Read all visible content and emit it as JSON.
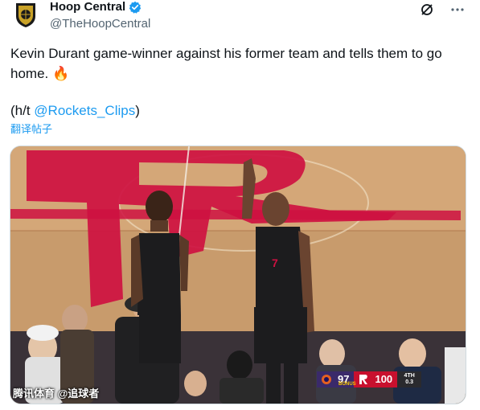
{
  "author": {
    "display_name": "Hoop Central",
    "handle": "@TheHoopCentral"
  },
  "tweet": {
    "text": "Kevin Durant game-winner against his former team and tells them to go home. 🔥",
    "ht_prefix": "(h/t ",
    "ht_link": "@Rockets_Clips",
    "ht_suffix": ")",
    "translate_label": "翻译帖子"
  },
  "media": {
    "watermark": "腾讯体育 @追球者",
    "scorebug": {
      "away_score": "97",
      "bonus_label": "BONUS",
      "home_score": "100",
      "period": "4TH",
      "clock": "0.3"
    }
  },
  "colors": {
    "link": "#1d9bf0",
    "verified": "#1d9bf0",
    "rockets_red": "#ce1141",
    "court": "#c89b6c"
  },
  "icons": {
    "verified": "verified-badge-icon",
    "grok": "grok-icon",
    "more": "more-dots-icon"
  }
}
